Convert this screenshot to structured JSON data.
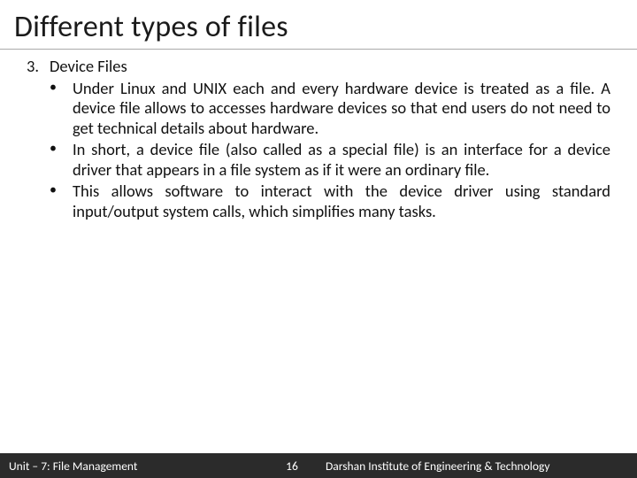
{
  "title": "Different types of files",
  "list": {
    "number": "3.",
    "heading": "Device Files",
    "bullets": [
      "Under Linux and UNIX each and every hardware device is treated as a file. A device file allows to accesses hardware devices so that end users do not need to get technical details about hardware.",
      "In short, a device file (also called as a special file) is an interface for a device driver that appears in a file system as if it were an ordinary file.",
      "This allows software to interact with the device driver using standard input/output system calls, which simplifies many tasks."
    ]
  },
  "footer": {
    "left": "Unit – 7: File Management",
    "page": "16",
    "right": "Darshan Institute of Engineering & Technology"
  }
}
